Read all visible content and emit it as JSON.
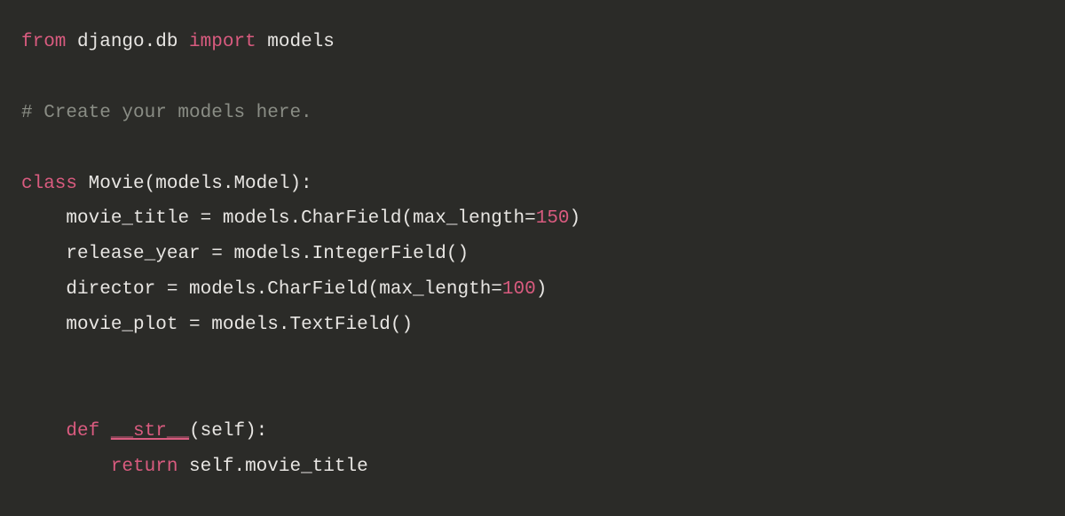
{
  "code": {
    "line1": {
      "kw_from": "from",
      "module": " django.db ",
      "kw_import": "import",
      "names": " models"
    },
    "line3": {
      "comment": "# Create your models here."
    },
    "line5": {
      "kw_class": "class",
      "rest": " Movie(models.Model):"
    },
    "line6": {
      "indent": "    ",
      "text": "movie_title = models.CharField(max_length=",
      "num": "150",
      "close": ")"
    },
    "line7": {
      "indent": "    ",
      "text": "release_year = models.IntegerField()"
    },
    "line8": {
      "indent": "    ",
      "text": "director = models.CharField(max_length=",
      "num": "100",
      "close": ")"
    },
    "line9": {
      "indent": "    ",
      "text": "movie_plot = models.TextField()"
    },
    "line12": {
      "indent": "    ",
      "kw_def": "def",
      "space": " ",
      "dunder": "__str__",
      "rest": "(self):"
    },
    "line13": {
      "indent": "        ",
      "kw_return": "return",
      "rest": " self.movie_title"
    }
  }
}
